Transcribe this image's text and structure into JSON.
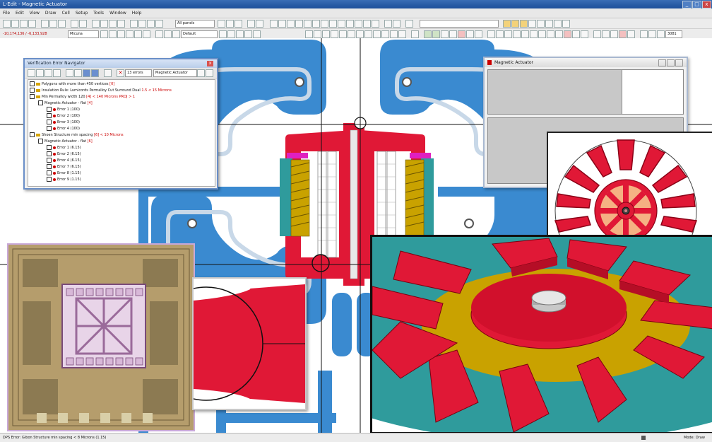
{
  "app": {
    "title": "L-Edit - Magnetic Actuator",
    "window_buttons": [
      "_",
      "□",
      "x"
    ]
  },
  "menu": {
    "items": [
      "File",
      "Edit",
      "View",
      "Draw",
      "Cell",
      "Setup",
      "Tools",
      "Window",
      "Help"
    ]
  },
  "toolbar": {
    "layers_combo": "All panels",
    "coordinates": "-10,174,136 / -6,133,928",
    "layer_combo": "Micuna",
    "style_combo": "Default",
    "zoom_value": "3081"
  },
  "navigator": {
    "title": "Verification Error Navigator",
    "errors_count": "13 errors",
    "cell_combo": "Magnetic Actuator",
    "close": "x",
    "rules": [
      {
        "label": "Polygons with more than 450 vertices",
        "count": "[0]"
      },
      {
        "label": "Insulation Rule: Lumicords Permalloy Cut Surround Dual",
        "count": "1.5 < 15 Microns"
      },
      {
        "label": "Min Permalloy width 120",
        "count": "[4] < 140 Microns PROJ > 1"
      }
    ],
    "sub1_cell": "Magnetic Actuator - flat",
    "sub1_count": "[4]",
    "sub1_errors": [
      "Error 1 (100)",
      "Error 2 (100)",
      "Error 3 (100)",
      "Error 4 (100)"
    ],
    "rule4": {
      "label": "Shoen Structure min spacing",
      "count": "[6] < 10 Microns"
    },
    "sub2_cell": "Magnetic Actuator - flat",
    "sub2_count": "[6]",
    "sub2_errors": [
      "Error 1 (6.15)",
      "Error 2 (6.15)",
      "Error 4 (6.15)",
      "Error 7 (6.15)",
      "Error 8 (1.15)",
      "Error 9 (1.15)"
    ]
  },
  "actuator_window": {
    "title": "Magnetic Actuator"
  },
  "status": {
    "left": "DPS Error: Gibon Structure min spacing < 8 Microns (1.15)",
    "right": "Mode: Draw"
  },
  "colors": {
    "coil_blue": "#3a8ad0",
    "permalloy_red": "#e01836",
    "cyan_plate": "#2f9b9c",
    "gold": "#c9a200",
    "chip_bg": "#bfa777"
  }
}
